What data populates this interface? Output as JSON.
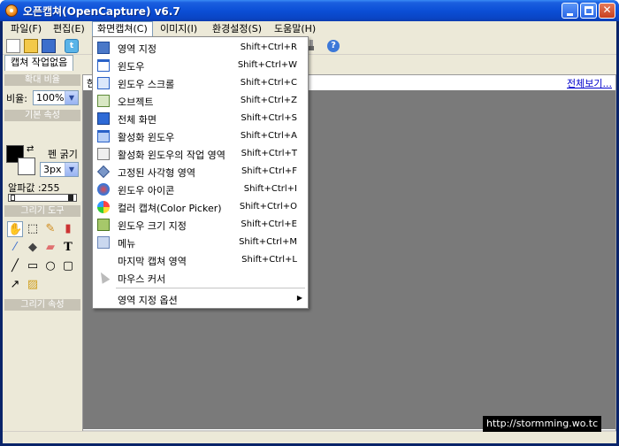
{
  "window": {
    "title": "오픈캡쳐(OpenCapture) v6.7"
  },
  "menubar": {
    "items": [
      {
        "label": "파일(F)"
      },
      {
        "label": "편집(E)"
      },
      {
        "label": "화면캡쳐(C)"
      },
      {
        "label": "이미지(I)"
      },
      {
        "label": "환경설정(S)"
      },
      {
        "label": "도움말(H)"
      }
    ]
  },
  "tabs": {
    "active": "캡쳐 작업없음"
  },
  "left_panel": {
    "zoom_header": "확대 비율",
    "zoom_label": "비율:",
    "zoom_value": "100%",
    "base_header": "기본 속성",
    "pen_label": "펜 굵기",
    "pen_value": "3px",
    "alpha_label": "알파값 :255",
    "tools_header": "그리기 도구",
    "props_header": "그리기 속성"
  },
  "canvas": {
    "header_text": "한",
    "view_all": "전체보기..."
  },
  "capture_menu": {
    "items": [
      {
        "label": "영역 지정",
        "shortcut": "Shift+Ctrl+R",
        "icon": "region-icon"
      },
      {
        "label": "윈도우",
        "shortcut": "Shift+Ctrl+W",
        "icon": "window-icon"
      },
      {
        "label": "윈도우 스크롤",
        "shortcut": "Shift+Ctrl+C",
        "icon": "scroll-window-icon"
      },
      {
        "label": "오브젝트",
        "shortcut": "Shift+Ctrl+Z",
        "icon": "object-icon"
      },
      {
        "label": "전체 화면",
        "shortcut": "Shift+Ctrl+S",
        "icon": "fullscreen-icon"
      },
      {
        "label": "활성화 윈도우",
        "shortcut": "Shift+Ctrl+A",
        "icon": "active-window-icon"
      },
      {
        "label": "활성화 윈도우의 작업 영역",
        "shortcut": "Shift+Ctrl+T",
        "icon": "active-client-icon"
      },
      {
        "label": "고정된 사각형 영역",
        "shortcut": "Shift+Ctrl+F",
        "icon": "fixed-rect-icon"
      },
      {
        "label": "윈도우 아이콘",
        "shortcut": "Shift+Ctrl+I",
        "icon": "window-icon-capture-icon"
      },
      {
        "label": "컬러 캡쳐(Color Picker)",
        "shortcut": "Shift+Ctrl+O",
        "icon": "color-picker-icon"
      },
      {
        "label": "윈도우 크기 지정",
        "shortcut": "Shift+Ctrl+E",
        "icon": "window-size-icon"
      },
      {
        "label": "메뉴",
        "shortcut": "Shift+Ctrl+M",
        "icon": "menu-capture-icon"
      },
      {
        "label": "마지막 캡쳐 영역",
        "shortcut": "Shift+Ctrl+L",
        "icon": "last-region-icon"
      },
      {
        "label": "마우스 커서",
        "shortcut": "",
        "icon": "mouse-cursor-icon"
      }
    ],
    "submenu": {
      "label": "영역 지정 옵션"
    }
  },
  "watermark": "http://stormming.wo.tc"
}
